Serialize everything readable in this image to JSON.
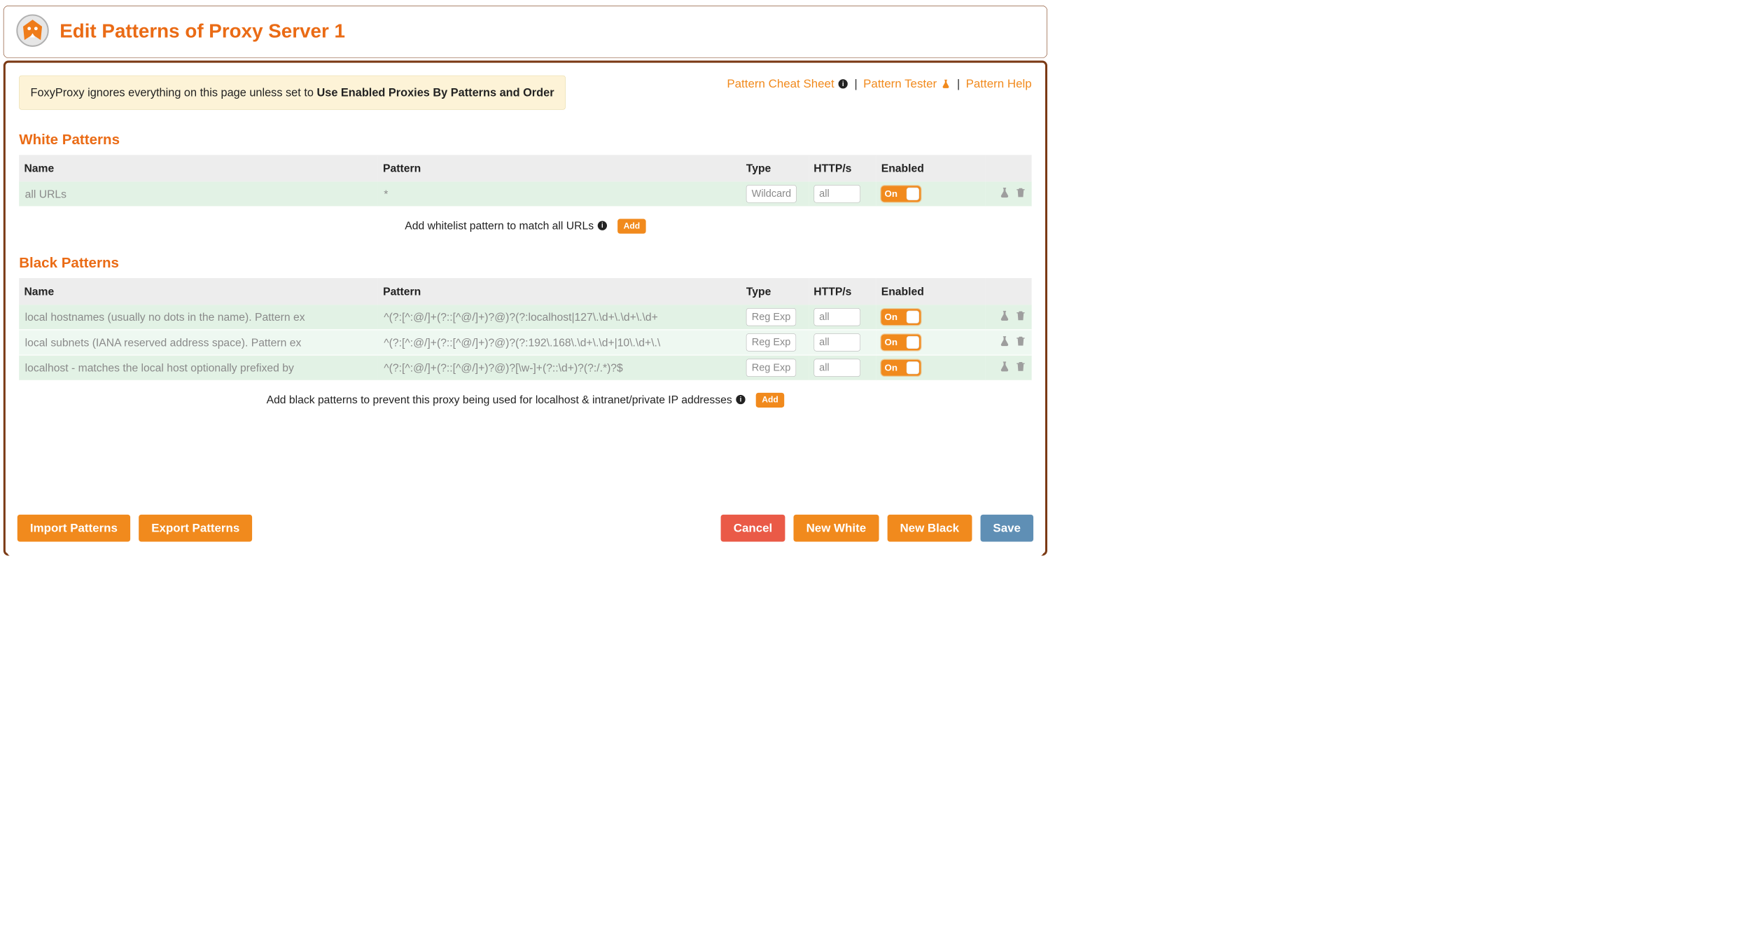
{
  "header": {
    "title": "Edit Patterns of Proxy Server 1"
  },
  "notice": {
    "prefix": "FoxyProxy ignores everything on this page unless set to ",
    "bold": "Use Enabled Proxies By Patterns and Order"
  },
  "help_links": {
    "cheat": "Pattern Cheat Sheet",
    "tester": "Pattern Tester",
    "help": "Pattern Help"
  },
  "sections": {
    "white": "White Patterns",
    "black": "Black Patterns"
  },
  "columns": {
    "name": "Name",
    "pattern": "Pattern",
    "type": "Type",
    "https": "HTTP/s",
    "enabled": "Enabled"
  },
  "toggle_on_label": "On",
  "white_rows": [
    {
      "name": "all URLs",
      "pattern": "*",
      "type": "Wildcard",
      "https": "all",
      "enabled": "On"
    }
  ],
  "black_rows": [
    {
      "name": "local hostnames (usually no dots in the name). Pattern ex",
      "pattern": "^(?:[^:@/]+(?::[^@/]+)?@)?(?:localhost|127\\.\\d+\\.\\d+\\.\\d+",
      "type": "Reg Exp",
      "https": "all",
      "enabled": "On"
    },
    {
      "name": "local subnets (IANA reserved address space). Pattern ex",
      "pattern": "^(?:[^:@/]+(?::[^@/]+)?@)?(?:192\\.168\\.\\d+\\.\\d+|10\\.\\d+\\.\\",
      "type": "Reg Exp",
      "https": "all",
      "enabled": "On"
    },
    {
      "name": "localhost - matches the local host optionally prefixed by",
      "pattern": "^(?:[^:@/]+(?::[^@/]+)?@)?[\\w-]+(?::\\d+)?(?:/.*)?$",
      "type": "Reg Exp",
      "https": "all",
      "enabled": "On"
    }
  ],
  "center_hints": {
    "white": "Add whitelist pattern to match all URLs",
    "black": "Add black patterns to prevent this proxy being used for localhost & intranet/private IP addresses",
    "add_btn": "Add"
  },
  "buttons": {
    "import": "Import Patterns",
    "export": "Export Patterns",
    "cancel": "Cancel",
    "new_white": "New White",
    "new_black": "New Black",
    "save": "Save"
  }
}
